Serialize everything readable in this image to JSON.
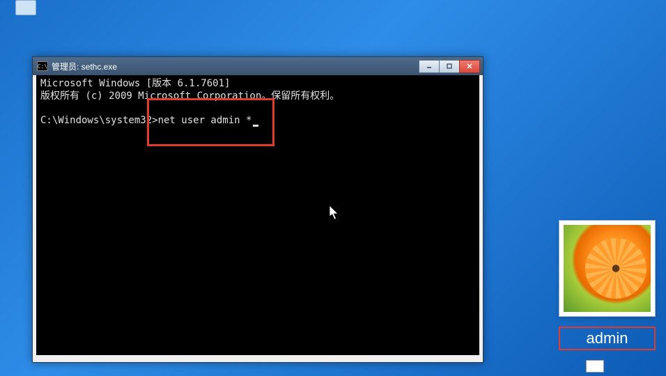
{
  "desktop": {
    "icon_name": "folder-icon"
  },
  "console": {
    "titlebar": {
      "icon_label": "C:\\",
      "title": "管理员: sethc.exe",
      "min_label": "—",
      "max_label": "□",
      "close_label": "×"
    },
    "body": {
      "line1": "Microsoft Windows [版本 6.1.7601]",
      "line2": "版权所有 (c) 2009 Microsoft Corporation。保留所有权利。",
      "prompt": "C:\\Windows\\system32>",
      "command": "net user admin *"
    }
  },
  "user_tile": {
    "username": "admin"
  },
  "highlight_colors": {
    "annotation": "#e33a2e"
  }
}
